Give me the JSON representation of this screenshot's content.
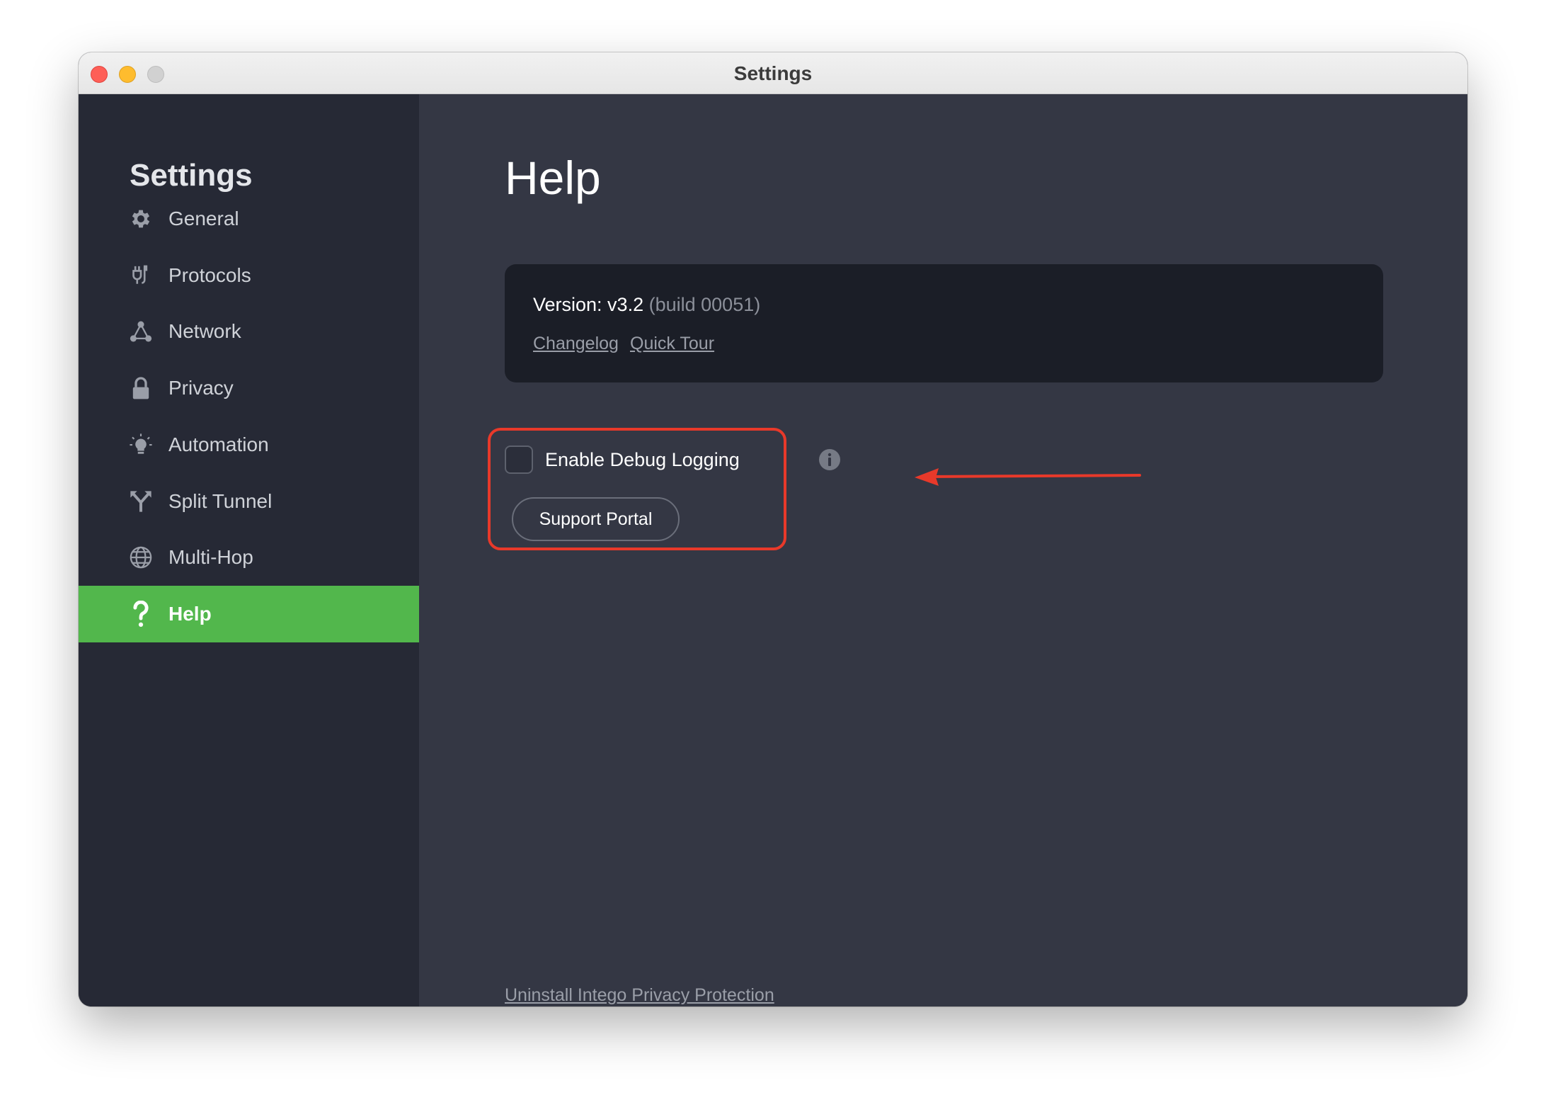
{
  "window": {
    "title": "Settings"
  },
  "sidebar": {
    "title": "Settings",
    "items": [
      {
        "label": "General",
        "icon": "gear-icon"
      },
      {
        "label": "Protocols",
        "icon": "plug-icon"
      },
      {
        "label": "Network",
        "icon": "network-icon"
      },
      {
        "label": "Privacy",
        "icon": "lock-icon"
      },
      {
        "label": "Automation",
        "icon": "lightbulb-icon"
      },
      {
        "label": "Split Tunnel",
        "icon": "split-icon"
      },
      {
        "label": "Multi-Hop",
        "icon": "globe-icon"
      },
      {
        "label": "Help",
        "icon": "question-icon",
        "active": true
      }
    ]
  },
  "main": {
    "title": "Help",
    "version_label": "Version: v3.2",
    "build_label": "(build 00051)",
    "links": {
      "changelog": "Changelog",
      "quick_tour": "Quick Tour"
    },
    "debug_logging": {
      "label": "Enable Debug Logging",
      "checked": false
    },
    "support_button": "Support Portal",
    "uninstall_link": "Uninstall Intego Privacy Protection"
  },
  "colors": {
    "sidebar_bg": "#262935",
    "main_bg": "#343744",
    "accent_green": "#52b74c",
    "annotation_red": "#e8392a",
    "card_bg": "#1b1e27"
  }
}
